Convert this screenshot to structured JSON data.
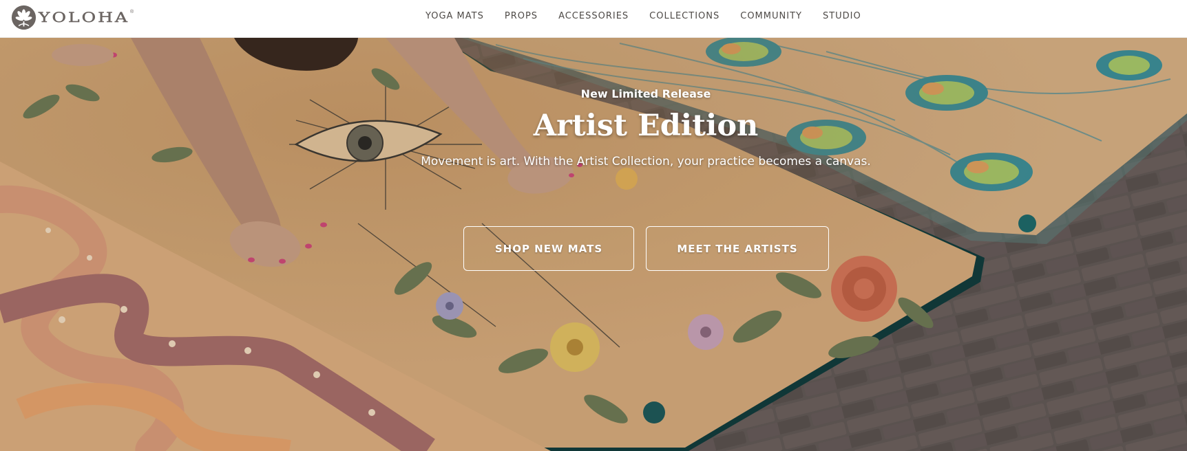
{
  "brand": {
    "name": "YOLOHA",
    "reg": "®"
  },
  "nav": {
    "items": [
      "YOGA MATS",
      "PROPS",
      "ACCESSORIES",
      "COLLECTIONS",
      "COMMUNITY",
      "STUDIO"
    ]
  },
  "hero": {
    "eyebrow": "New Limited Release",
    "title": "Artist Edition",
    "subtitle": "Movement is art. With the Artist Collection, your practice becomes a canvas.",
    "buttons": {
      "shop": "SHOP NEW MATS",
      "artists": "MEET THE ARTISTS"
    }
  },
  "colors": {
    "brand_gray": "#6b6562",
    "nav_text": "#4e4a47",
    "mat_cork": "#d6ab7c",
    "mat_teal": "#123c3c",
    "snake_mauve": "#a86e6a",
    "brick": "#6e6461"
  }
}
